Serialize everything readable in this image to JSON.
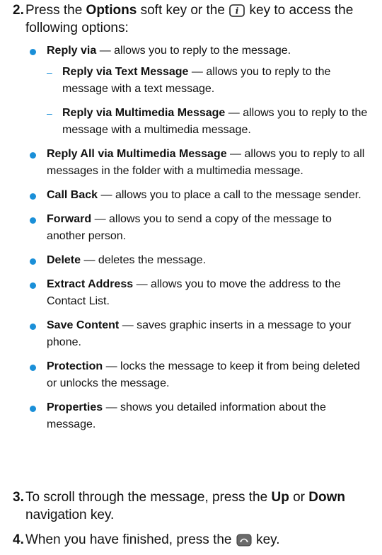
{
  "steps": [
    {
      "num": "2.",
      "t1": "Press the ",
      "b1": "Options",
      "t2": " soft key or the ",
      "icon": "info-key-icon",
      "t3": " key to access the following options:"
    },
    {
      "num": "3.",
      "t1": "To scroll through the message, press the ",
      "b1": "Up",
      "t2": " or ",
      "b2": "Down",
      "t3": " navigation key."
    },
    {
      "num": "4.",
      "t1": "When you have finished, press the ",
      "icon": "end-key-icon",
      "t2": " key."
    }
  ],
  "options": [
    {
      "label": "Reply via",
      "desc": " — allows you to reply to the message.",
      "sub": [
        {
          "label": "Reply via Text Message",
          "desc": " — allows you to reply to the message with a text message."
        },
        {
          "label": "Reply via Multimedia Message",
          "desc": " — allows you to reply to the message with a multimedia message."
        }
      ]
    },
    {
      "label": "Reply All via Multimedia Message",
      "desc": " — allows you to reply to all messages in the folder with a multimedia message."
    },
    {
      "label": "Call Back",
      "desc": " — allows you to place a call to the message sender."
    },
    {
      "label": "Forward",
      "desc": " — allows you to send a copy of the message to another person."
    },
    {
      "label": "Delete",
      "desc": " — deletes the message."
    },
    {
      "label": "Extract Address",
      "desc": " — allows you to move the address to the Contact List."
    },
    {
      "label": "Save Content",
      "desc": " — saves graphic inserts in a message to your phone."
    },
    {
      "label": "Protection",
      "desc": " — locks the message to keep it from being deleted or unlocks the message."
    },
    {
      "label": "Properties",
      "desc": " — shows you detailed information about the message."
    }
  ],
  "colors": {
    "bullet": "#1a8fd8",
    "text": "#111111"
  },
  "markers": {
    "dash": "–"
  }
}
